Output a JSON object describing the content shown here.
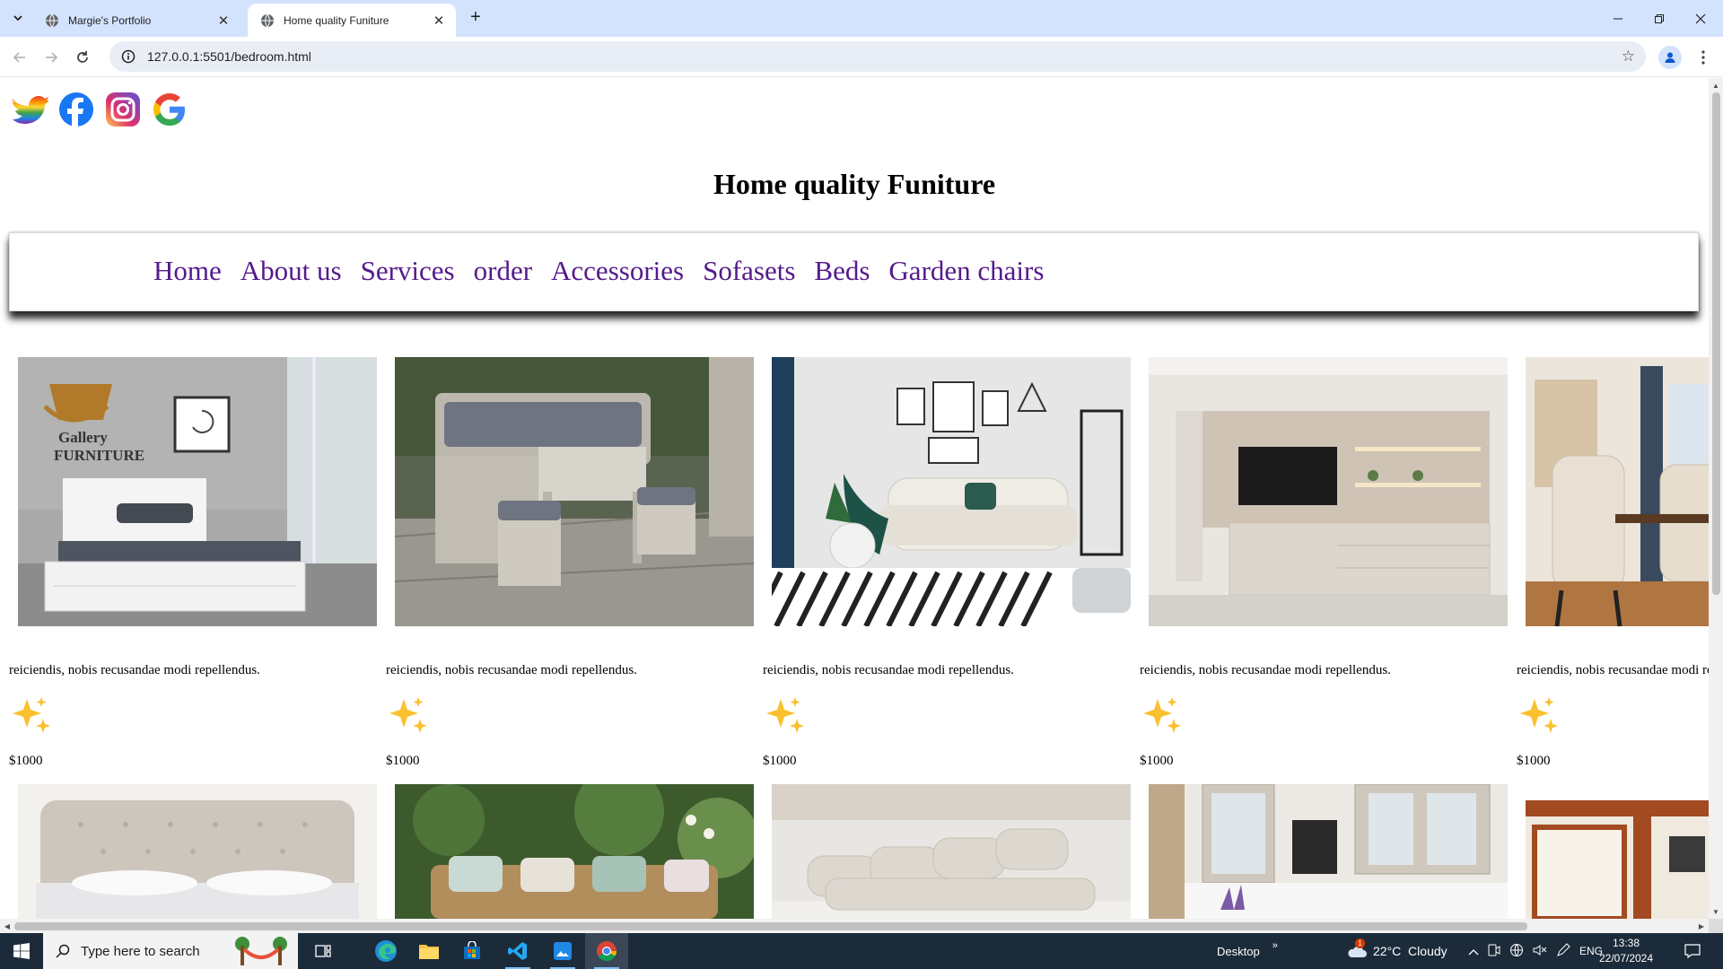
{
  "browser": {
    "tabs": [
      {
        "title": "Margie's Portfolio",
        "active": false
      },
      {
        "title": "Home quality Funiture",
        "active": true
      }
    ],
    "url": "127.0.0.1:5501/bedroom.html"
  },
  "page": {
    "title": "Home quality Funiture",
    "nav": [
      "Home",
      "About us",
      "Services",
      "order",
      "Accessories",
      "Sofasets",
      "Beds",
      "Garden chairs"
    ],
    "products_row1": [
      {
        "image": "bed-gallery-furniture",
        "logo_text_1": "Gallery",
        "logo_text_2": "FURNITURE",
        "desc": "reiciendis, nobis recusandae modi repellendus.",
        "price": "$1000"
      },
      {
        "image": "garden-rattan-set",
        "desc": "reiciendis, nobis recusandae modi repellendus.",
        "price": "$1000"
      },
      {
        "image": "living-room-sofa",
        "desc": "reiciendis, nobis recusandae modi repellendus.",
        "price": "$1000"
      },
      {
        "image": "tv-wall-unit",
        "desc": "reiciendis, nobis recusandae modi repellendus.",
        "price": "$1000"
      },
      {
        "image": "dining-chairs",
        "desc": "reiciendis, nobis recusandae modi repellendus.",
        "price": "$1000"
      }
    ],
    "products_row2": [
      {
        "image": "tufted-headboard-bed"
      },
      {
        "image": "garden-sofa"
      },
      {
        "image": "modular-sofa"
      },
      {
        "image": "kitchen-cabinets"
      },
      {
        "image": "kitchen-window"
      }
    ]
  },
  "taskbar": {
    "search_placeholder": "Type here to search",
    "desktop_label": "Desktop",
    "weather_badge": "1",
    "weather": "22°C  Cloudy",
    "language": "ENG",
    "time": "13:38",
    "date": "22/07/2024"
  },
  "colors": {
    "link": "#551a8b",
    "tabstrip": "#d3e3fd",
    "taskbar": "#1c2b3a"
  }
}
